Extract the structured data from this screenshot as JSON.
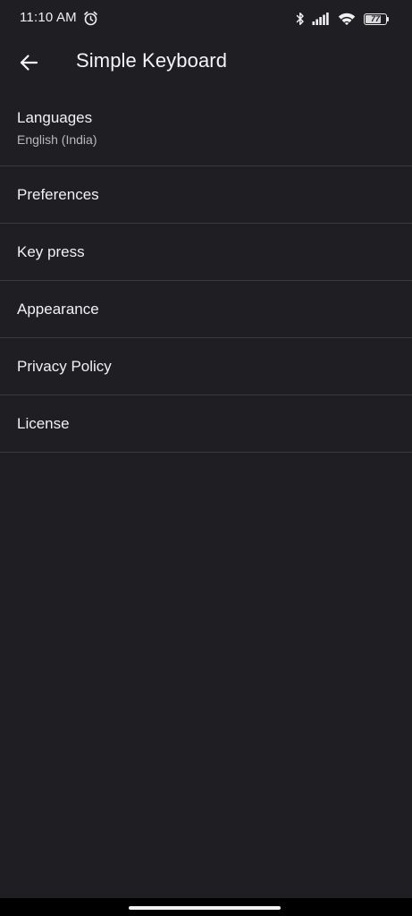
{
  "status_bar": {
    "time": "11:10 AM",
    "battery_level": "77",
    "battery_fraction": 0.77,
    "icons": [
      "alarm-icon",
      "bluetooth-icon",
      "signal-icon",
      "wifi-icon",
      "battery-icon"
    ]
  },
  "app_bar": {
    "title": "Simple Keyboard",
    "back_icon": "arrow-left-icon"
  },
  "settings": {
    "items": [
      {
        "id": "languages",
        "title": "Languages",
        "subtitle": "English (India)"
      },
      {
        "id": "preferences",
        "title": "Preferences"
      },
      {
        "id": "key-press",
        "title": "Key press"
      },
      {
        "id": "appearance",
        "title": "Appearance"
      },
      {
        "id": "privacy-policy",
        "title": "Privacy Policy"
      },
      {
        "id": "license",
        "title": "License"
      }
    ]
  },
  "colors": {
    "background": "#1f1e23",
    "divider": "#3a393e",
    "text_primary": "#f1f1f3",
    "text_secondary": "#b9b8bd",
    "nav_bar": "#000000"
  }
}
